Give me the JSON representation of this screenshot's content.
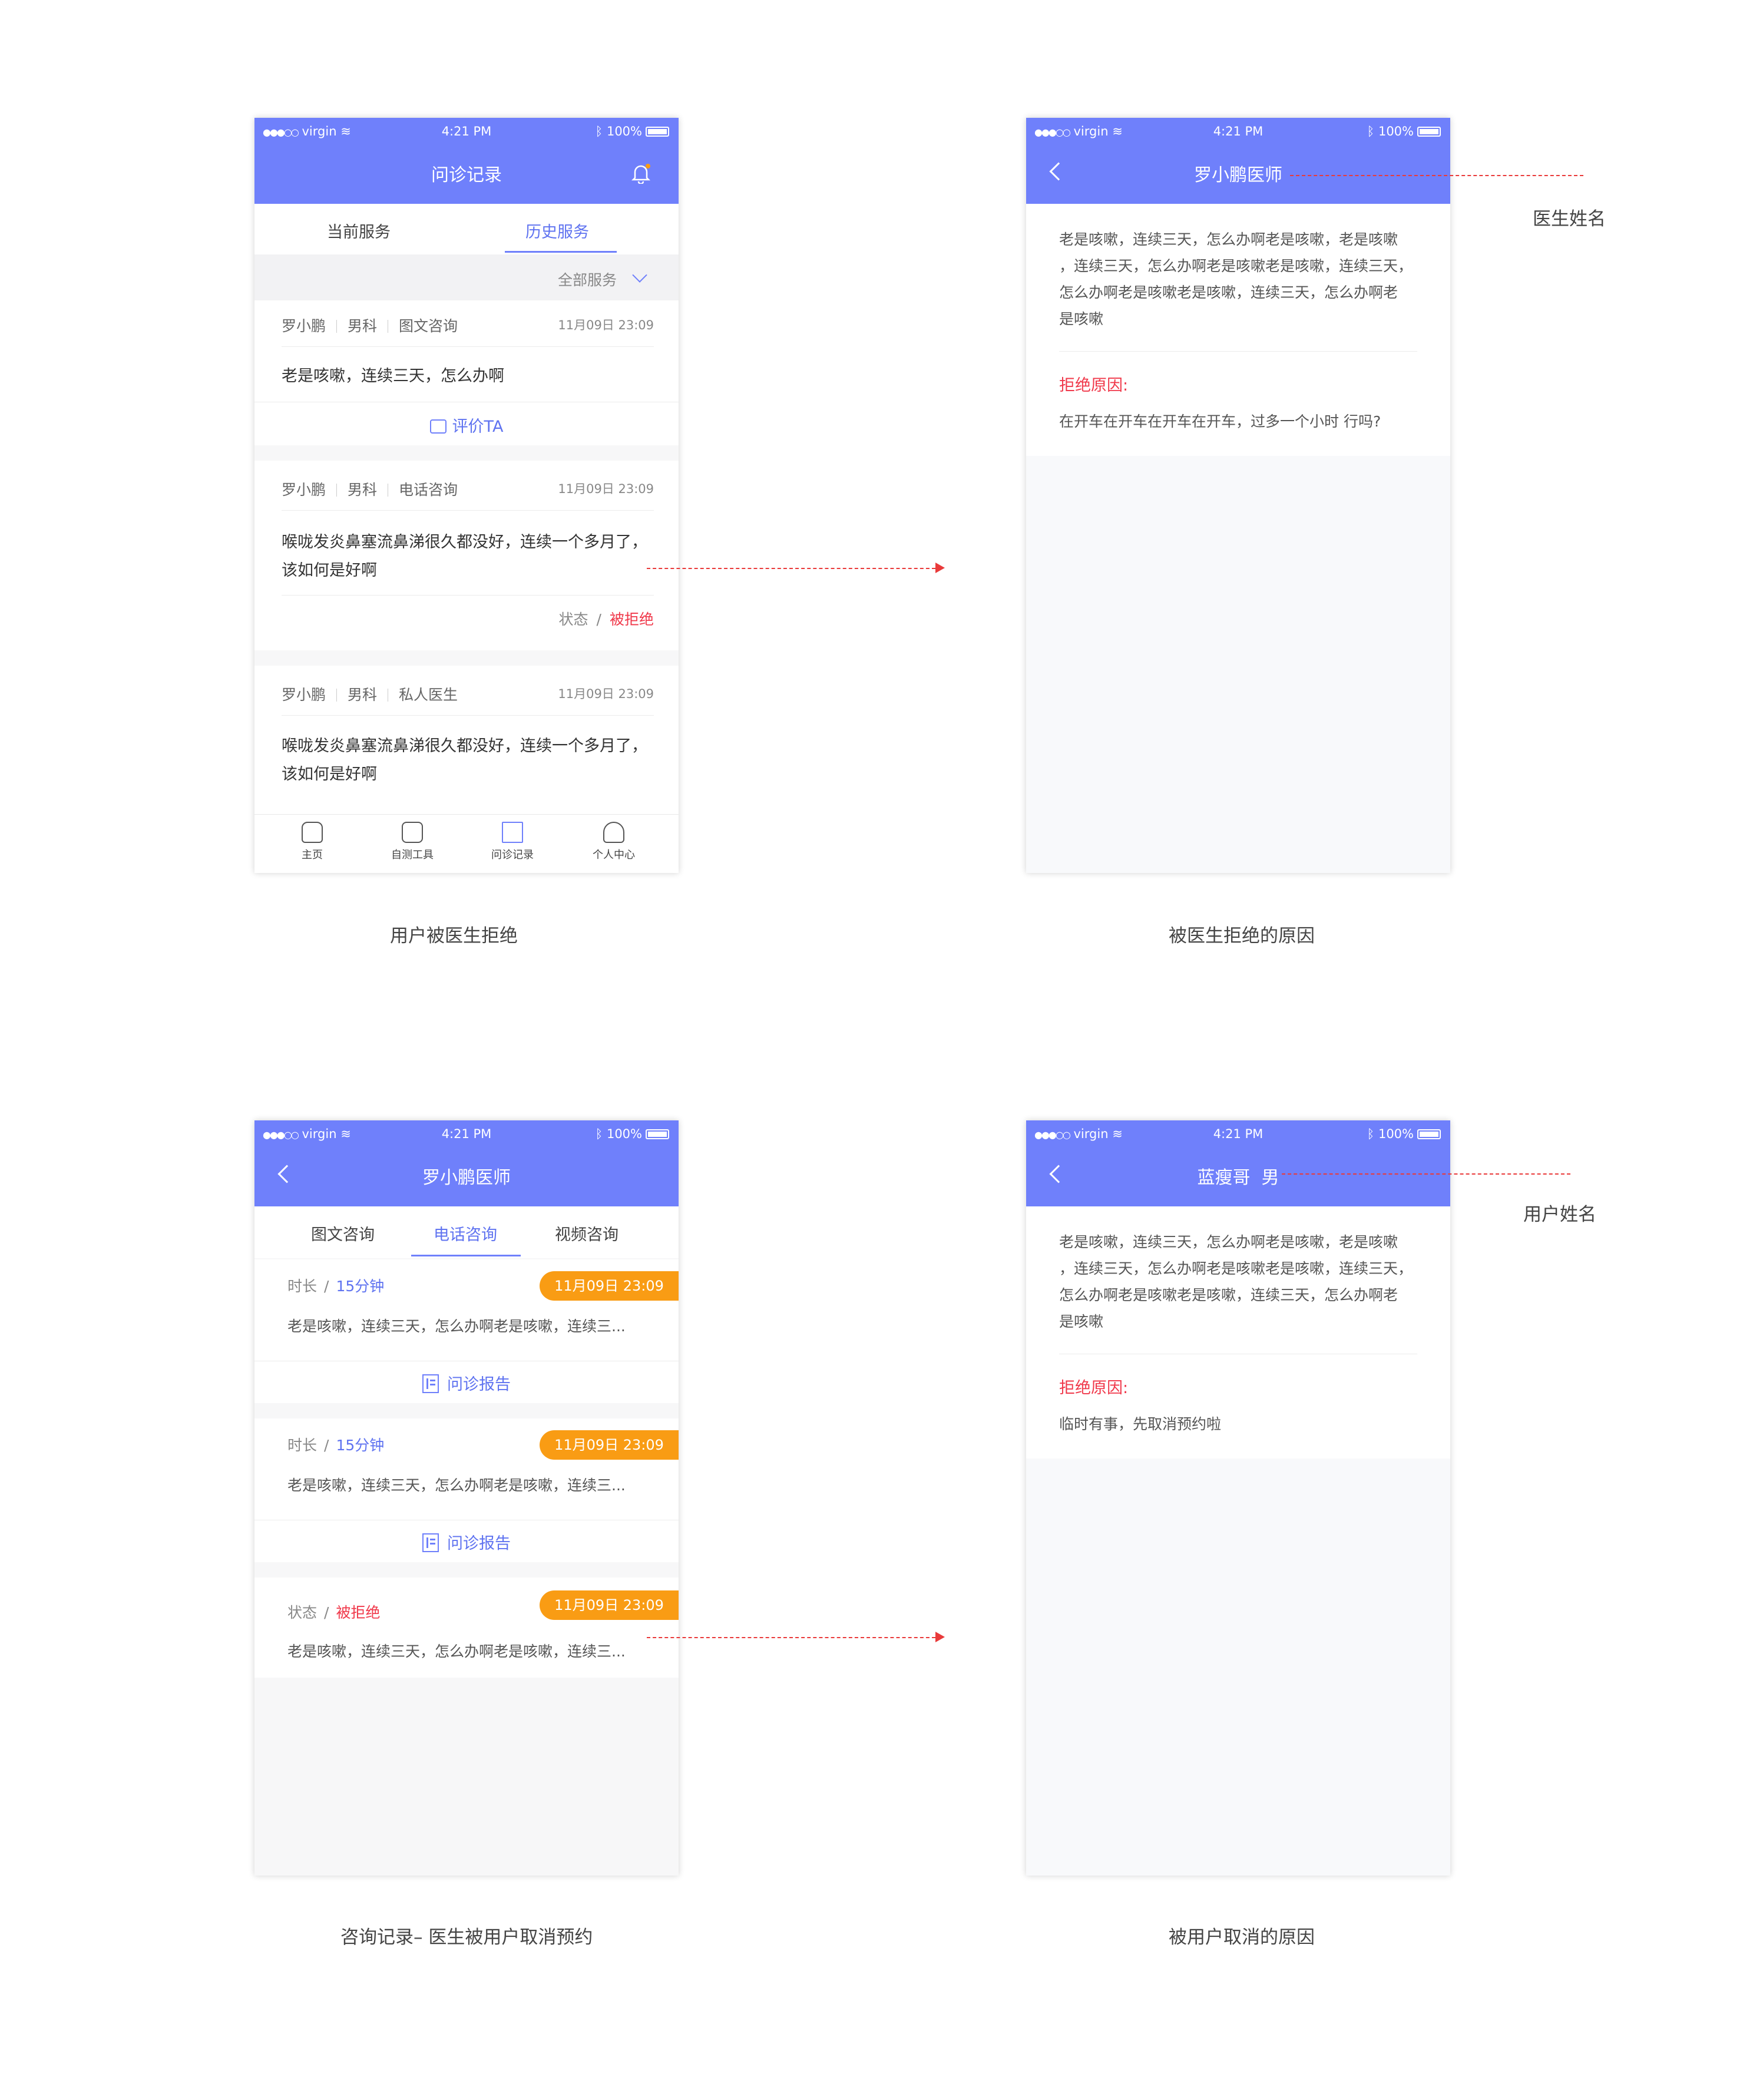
{
  "status_bar": {
    "carrier": "virgin",
    "time": "4:21 PM",
    "battery": "100%"
  },
  "screen1": {
    "title": "问诊记录",
    "tabs": [
      "当前服务",
      "历史服务"
    ],
    "filter": "全部服务",
    "cards": [
      {
        "name": "罗小鹏",
        "dept": "男科",
        "type": "图文咨询",
        "time": "11月09日 23:09",
        "text1": "老是咳嗽，连续三天，怎么办啊",
        "action": "评价TA"
      },
      {
        "name": "罗小鹏",
        "dept": "男科",
        "type": "电话咨询",
        "time": "11月09日 23:09",
        "text1": "喉咙发炎鼻塞流鼻涕很久都没好，连续一个多月了，",
        "text2": "该如何是好啊",
        "status_label": "状态",
        "status_value": "被拒绝"
      },
      {
        "name": "罗小鹏",
        "dept": "男科",
        "type": "私人医生",
        "time": "11月09日 23:09",
        "text1": "喉咙发炎鼻塞流鼻涕很久都没好，连续一个多月了，",
        "text2": "该如何是好啊"
      }
    ],
    "tabbar": [
      "主页",
      "自测工具",
      "问诊记录",
      "个人中心"
    ],
    "caption": "用户被医生拒绝"
  },
  "screen2": {
    "title": "罗小鹏医师",
    "lines": [
      "老是咳嗽，连续三天，怎么办啊老是咳嗽，老是咳嗽",
      "，连续三天，怎么办啊老是咳嗽老是咳嗽，连续三天，",
      "怎么办啊老是咳嗽老是咳嗽，连续三天，怎么办啊老",
      "是咳嗽"
    ],
    "reason_label": "拒绝原因:",
    "reason": "在开车在开车在开车在开车，过多一个小时 行吗?",
    "annotation": "医生姓名",
    "caption": "被医生拒绝的原因"
  },
  "screen3": {
    "title": "罗小鹏医师",
    "tabs": [
      "图文咨询",
      "电话咨询",
      "视频咨询"
    ],
    "cards": [
      {
        "label": "时长",
        "value": "15分钟",
        "badge": "11月09日  23:09",
        "text": "老是咳嗽，连续三天，怎么办啊老是咳嗽，连续三...",
        "action": "问诊报告"
      },
      {
        "label": "时长",
        "value": "15分钟",
        "badge": "11月09日  23:09",
        "text": "老是咳嗽，连续三天，怎么办啊老是咳嗽，连续三...",
        "action": "问诊报告"
      },
      {
        "label": "状态",
        "value": "被拒绝",
        "badge": "11月09日  23:09",
        "text": "老是咳嗽，连续三天，怎么办啊老是咳嗽，连续三..."
      }
    ],
    "caption": "咨询记录– 医生被用户取消预约"
  },
  "screen4": {
    "title": "蓝瘦哥  男",
    "lines": [
      "老是咳嗽，连续三天，怎么办啊老是咳嗽，老是咳嗽",
      "，连续三天，怎么办啊老是咳嗽老是咳嗽，连续三天，",
      "怎么办啊老是咳嗽老是咳嗽，连续三天，怎么办啊老",
      "是咳嗽"
    ],
    "reason_label": "拒绝原因:",
    "reason": "临时有事，先取消预约啦",
    "annotation": "用户姓名",
    "caption": "被用户取消的原因"
  },
  "separator": "/",
  "colors": {
    "primary": "#6f80fb",
    "reject": "#f0384a",
    "badge": "#f99c14"
  }
}
